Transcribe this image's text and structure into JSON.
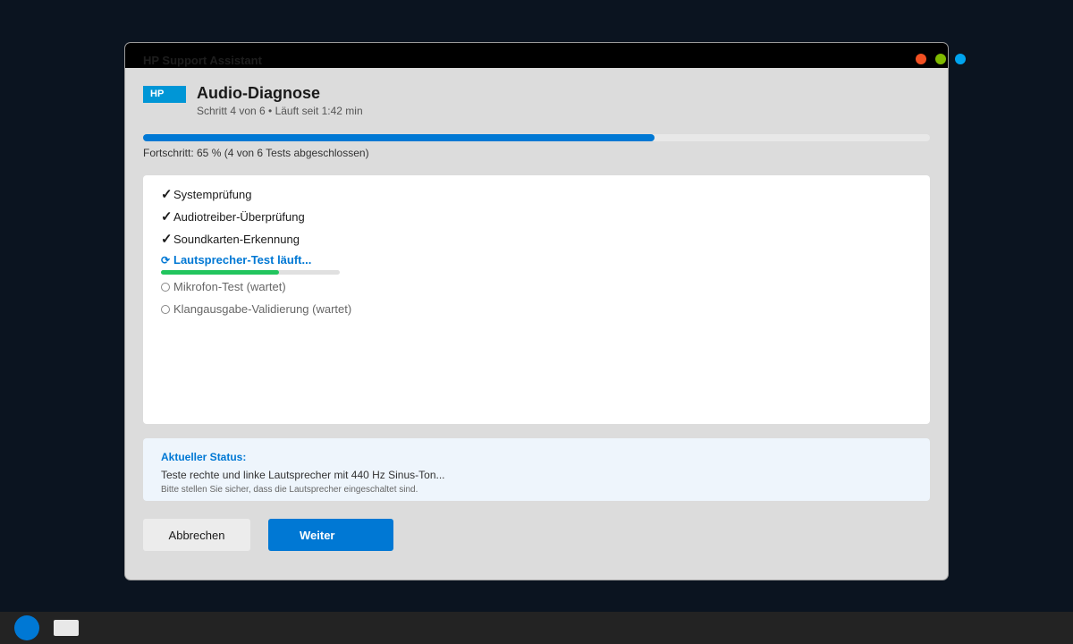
{
  "window": {
    "title": "HP Support Assistant",
    "brand": "HP"
  },
  "header": {
    "title": "Audio-Diagnose",
    "subtitle": "Schritt 4 von 6 • Läuft seit 1:42 min"
  },
  "progress": {
    "percent": 65,
    "label": "Fortschritt: 65 % (4 von 6 Tests abgeschlossen)"
  },
  "tests": [
    {
      "mark": "✓",
      "label": "Systemprüfung",
      "state": "done"
    },
    {
      "mark": "✓",
      "label": "Audiotreiber-Überprüfung",
      "state": "done"
    },
    {
      "mark": "✓",
      "label": "Soundkarten-Erkennung",
      "state": "done"
    },
    {
      "mark": "⟳",
      "label": "Lautsprecher-Test läuft...",
      "state": "running",
      "subprogress": 0.66
    },
    {
      "mark": "",
      "label": "Mikrofon-Test (wartet)",
      "state": "waiting"
    },
    {
      "mark": "",
      "label": "Klangausgabe-Validierung (wartet)",
      "state": "waiting"
    }
  ],
  "status": {
    "heading": "Aktueller Status:",
    "text": "Teste rechte und linke Lautsprecher mit 440 Hz Sinus-Ton...",
    "hint": "Bitte stellen Sie sicher, dass die Lautsprecher eingeschaltet sind."
  },
  "buttons": {
    "cancel": "Abbrechen",
    "next": "Weiter"
  },
  "colors": {
    "accent": "#0078d4",
    "brand": "#0096d6",
    "success": "#22c55e",
    "close": "#f25022",
    "minimize": "#7fba00",
    "maximize": "#00a4ef"
  }
}
